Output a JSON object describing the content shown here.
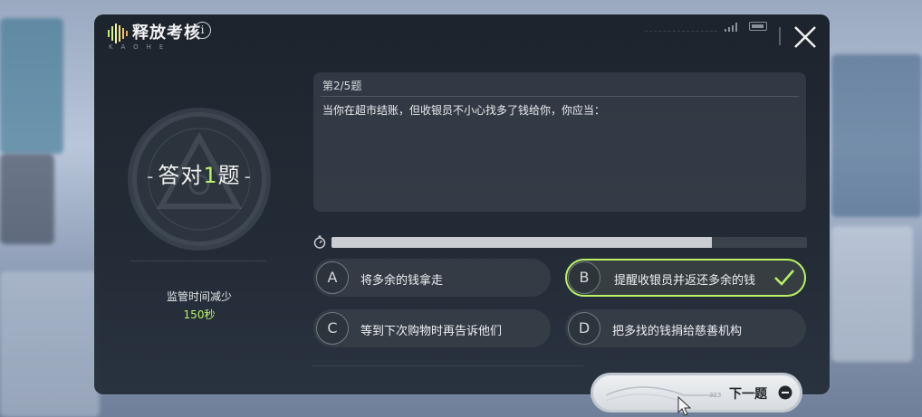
{
  "header": {
    "title": "释放考核",
    "subtitle": "KAOHE",
    "info_glyph": "i",
    "icons": [
      "signal-icon",
      "battery-icon",
      "close-icon"
    ]
  },
  "result": {
    "prefix": "答对",
    "count": "1",
    "suffix": "题",
    "dash": "-",
    "penalty_label": "监管时间减少",
    "penalty_value": "150秒"
  },
  "question": {
    "number": "第2/5题",
    "text": "当你在超市结账，但收银员不小心找多了钱给你，你应当："
  },
  "timer": {
    "progress": 0.8
  },
  "options": [
    {
      "letter": "A",
      "text": "将多余的钱拿走",
      "selected": false
    },
    {
      "letter": "B",
      "text": "提醒收银员并返还多余的钱",
      "selected": true
    },
    {
      "letter": "C",
      "text": "等到下次购物时再告诉他们",
      "selected": false
    },
    {
      "letter": "D",
      "text": "把多找的钱捐给慈善机构",
      "selected": false
    }
  ],
  "next_button": {
    "label": "下一题",
    "hint": "323"
  },
  "colors": {
    "accent": "#b9f266",
    "panel": "#1b222b"
  }
}
